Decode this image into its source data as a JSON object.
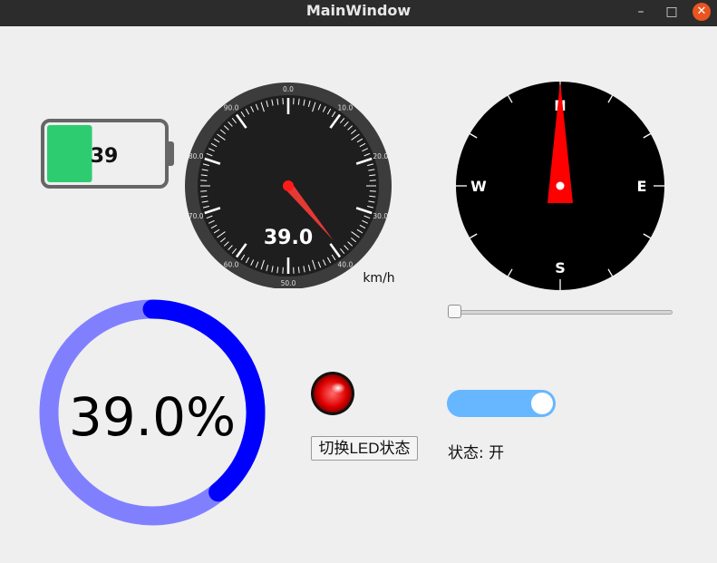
{
  "window": {
    "title": "MainWindow",
    "minimize_glyph": "–",
    "maximize_glyph": "□",
    "close_glyph": "✕"
  },
  "battery": {
    "level_percent": 39,
    "label": "39",
    "fill_color": "#2ecc71"
  },
  "speedometer": {
    "value": 39.0,
    "display": "39.0",
    "unit": "km/h",
    "min": 0,
    "max": 100,
    "tick_labels": [
      "0.0",
      "10.0",
      "20.0",
      "30.0",
      "40.0",
      "50.0",
      "60.0",
      "70.0",
      "80.0",
      "90.0"
    ]
  },
  "compass": {
    "labels": {
      "north": "N",
      "east": "E",
      "south": "S",
      "west": "W"
    },
    "heading_deg": 0
  },
  "slider": {
    "value_fraction": 0.0
  },
  "progress_ring": {
    "value_percent": 39.0,
    "display": "39.0%",
    "track_color": "#8080ff",
    "bar_color": "#0000ff"
  },
  "led": {
    "state": "on",
    "color": "#e00000",
    "button_label": "切换LED状态"
  },
  "toggle_switch": {
    "checked": true,
    "status_text": "状态: 开"
  }
}
